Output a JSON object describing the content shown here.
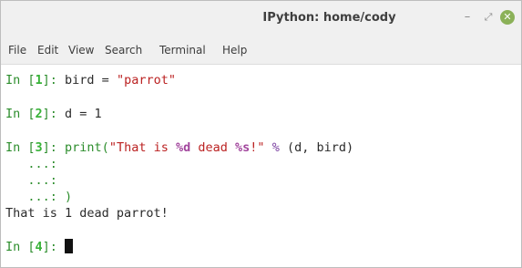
{
  "window": {
    "title": "IPython: home/cody",
    "controls": {
      "minimize": "–",
      "maximize": "⤢",
      "close": "✕"
    }
  },
  "menu": [
    "File",
    "Edit",
    "View",
    "Search",
    "Terminal",
    "Help"
  ],
  "terminal": {
    "in_label": "In [",
    "in_close": "]: ",
    "cell1": {
      "num": "1",
      "code": "bird = ",
      "string": "\"parrot\""
    },
    "cell2": {
      "num": "2",
      "code": "d = 1"
    },
    "cell3": {
      "num": "3",
      "func": "print(",
      "str_a": "\"That is ",
      "fmt1": "%d",
      "str_b": " dead ",
      "fmt2": "%s",
      "str_c": "!\"",
      "op": " % ",
      "rest": "(d, bird)",
      "continuation": "   ...:",
      "continuation_close": "   ...: )"
    },
    "output": "That is 1 dead parrot!",
    "cell4": {
      "num": "4"
    }
  }
}
